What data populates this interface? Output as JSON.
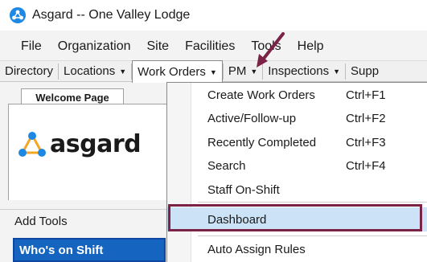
{
  "window": {
    "title": "Asgard -- One Valley Lodge"
  },
  "menubar": [
    "File",
    "Organization",
    "Site",
    "Facilities",
    "Tools",
    "Help"
  ],
  "toolbar": [
    {
      "label": "Directory",
      "has_caret": false
    },
    {
      "label": "Locations",
      "has_caret": true
    },
    {
      "label": "Work Orders",
      "has_caret": true,
      "active": true
    },
    {
      "label": "PM",
      "has_caret": true
    },
    {
      "label": "Inspections",
      "has_caret": true
    },
    {
      "label": "Supp",
      "has_caret": false
    }
  ],
  "left_pane": {
    "tab_label": "Welcome Page",
    "logo_text": "asgard",
    "add_tools_label": "Add Tools",
    "whos_on_shift_label": "Who's on Shift"
  },
  "dropdown": {
    "items": [
      {
        "label": "Create Work Orders",
        "shortcut": "Ctrl+F1"
      },
      {
        "label": "Active/Follow-up",
        "shortcut": "Ctrl+F2"
      },
      {
        "label": "Recently Completed",
        "shortcut": "Ctrl+F3"
      },
      {
        "label": "Search",
        "shortcut": "Ctrl+F4"
      },
      {
        "label": "Staff On-Shift",
        "shortcut": ""
      },
      {
        "label": "Dashboard",
        "shortcut": "",
        "highlighted": true
      },
      {
        "label": "Auto Assign Rules",
        "shortcut": ""
      }
    ]
  },
  "colors": {
    "accent_blue": "#1565c0",
    "highlight_fill": "#cce3f7",
    "annotation": "#7b2346"
  },
  "icons": {
    "app": "asgard-logo-icon",
    "caret": "caret-down-icon"
  }
}
